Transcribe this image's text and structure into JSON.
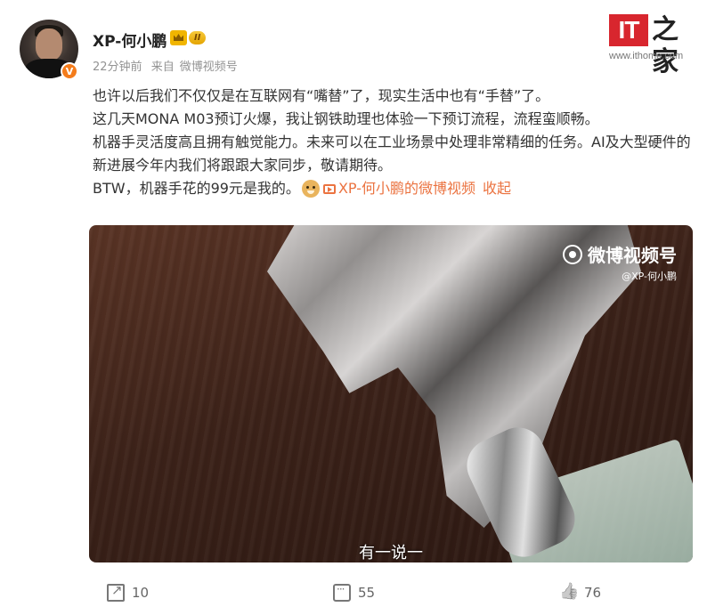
{
  "post": {
    "username": "XP-何小鹏",
    "level_badge": "II",
    "verified_badge": "V",
    "time": "22分钟前",
    "source_prefix": "来自",
    "source": "微博视频号",
    "content": {
      "line1": "也许以后我们不仅仅是在互联网有“嘴替”了，现实生活中也有“手替”了。",
      "line2": "这几天MONA M03预订火爆，我让钢铁助理也体验一下预订流程，流程蛮顺畅。",
      "line3": "机器手灵活度高且拥有触觉能力。未来可以在工业场景中处理非常精细的任务。AI及大型硬件的新进展今年内我们将跟跟大家同步，敬请期待。",
      "line4": "BTW，机器手花的99元是我的。",
      "video_link": "XP-何小鹏的微博视频",
      "collapse": "收起"
    },
    "video": {
      "watermark_title": "微博视频号",
      "watermark_handle": "@XP-何小鹏",
      "subtitle": "有一说一"
    },
    "actions": {
      "share_count": "10",
      "comment_count": "55",
      "like_count": "76"
    }
  },
  "site_logo": {
    "mark": "IT",
    "name": "之家",
    "url": "www.ithome.com"
  },
  "colors": {
    "link": "#eb7340",
    "logo_red": "#d8262e",
    "meta_gray": "#939393"
  },
  "icons": [
    "share-icon",
    "comment-icon",
    "like-icon",
    "video-link-icon",
    "weibo-eye-icon",
    "crown-icon"
  ]
}
